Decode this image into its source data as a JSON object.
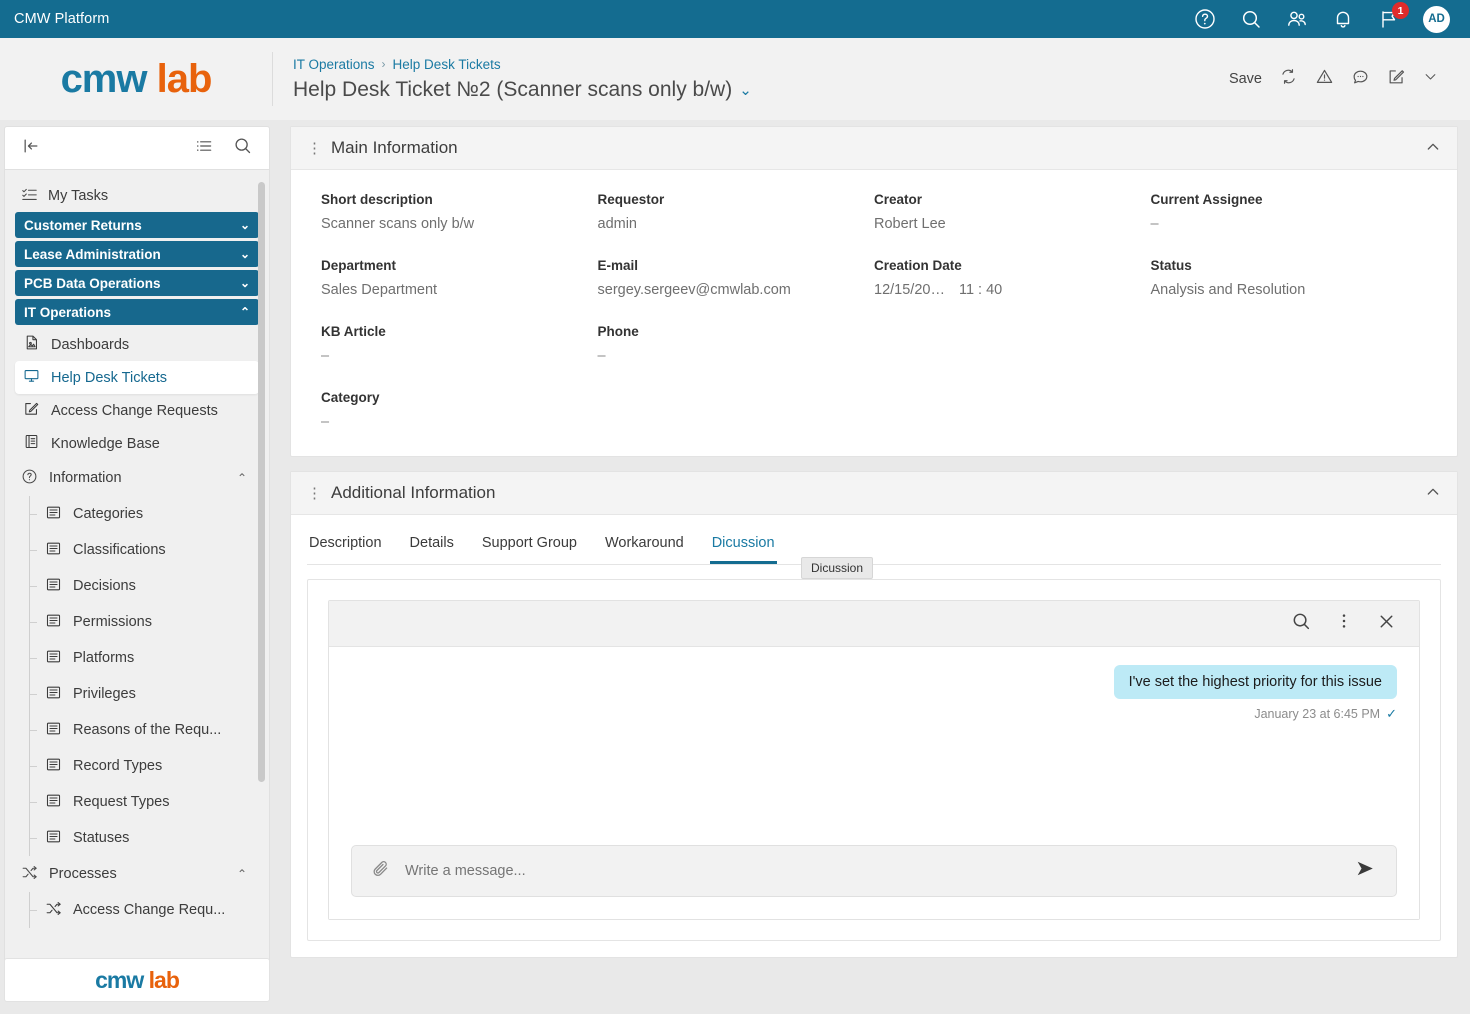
{
  "topbar": {
    "title": "CMW Platform",
    "icons": [
      "help-icon",
      "search-icon",
      "users-icon",
      "bell-icon",
      "flag-icon"
    ],
    "notification_count": "1",
    "avatar_initials": "AD",
    "background": "#146c90"
  },
  "header": {
    "logo_part1": "cmw",
    "logo_part2": "lab",
    "breadcrumb": [
      "IT Operations",
      "Help Desk Tickets"
    ],
    "breadcrumb_separator": "›",
    "record_title": "Help Desk Ticket №2 (Scanner scans only b/w)",
    "title_chevron": "⌄",
    "accent_blue": "#1a7aa3",
    "accent_orange": "#e8620c"
  },
  "toolbar": {
    "save_label": "Save",
    "icons": [
      "refresh-icon",
      "warning-icon",
      "comment-icon",
      "edit-icon",
      "chevron-down-icon"
    ]
  },
  "sidebar": {
    "collapse_label": "|←",
    "list_icon": "list-icon",
    "search_icon": "search-icon",
    "my_tasks": "My Tasks",
    "groups": [
      {
        "label": "Customer Returns",
        "chevron": "⌄",
        "expanded": false
      },
      {
        "label": "Lease Administration",
        "chevron": "⌄",
        "expanded": false
      },
      {
        "label": "PCB Data Operations",
        "chevron": "⌄",
        "expanded": false
      },
      {
        "label": "IT Operations",
        "chevron": "⌃",
        "expanded": true
      }
    ],
    "items": [
      {
        "label": "Dashboards",
        "icon": "document-icon",
        "active": false
      },
      {
        "label": "Help Desk Tickets",
        "icon": "monitor-icon",
        "active": true
      },
      {
        "label": "Access Change Requests",
        "icon": "edit-square-icon",
        "active": false
      },
      {
        "label": "Knowledge Base",
        "icon": "book-icon",
        "active": false
      }
    ],
    "information_section": {
      "label": "Information",
      "icon": "question-circle-icon",
      "chevron": "⌃"
    },
    "information_items": [
      "Categories",
      "Classifications",
      "Decisions",
      "Permissions",
      "Platforms",
      "Privileges",
      "Reasons of the Requ...",
      "Record Types",
      "Request Types",
      "Statuses"
    ],
    "processes_section": {
      "label": "Processes",
      "icon": "process-icon",
      "chevron": "⌃"
    },
    "processes_items": [
      "Access Change Requ..."
    ],
    "footer_logo_part1": "cmw",
    "footer_logo_part2": "lab",
    "group_color": "#17688d"
  },
  "main_information": {
    "panel_title": "Main Information",
    "collapse_chevron": "⌃",
    "rows": [
      [
        {
          "label": "Short description",
          "value": "Scanner scans only b/w"
        },
        {
          "label": "Requestor",
          "value": "admin"
        },
        {
          "label": "Creator",
          "value": "Robert Lee"
        },
        {
          "label": "Current Assignee",
          "value": "–"
        }
      ],
      [
        {
          "label": "Department",
          "value": "Sales Department"
        },
        {
          "label": "E-mail",
          "value": "sergey.sergeev@cmwlab.com"
        },
        {
          "label": "Creation Date",
          "value": "12/15/20…",
          "value2": "11 : 40"
        },
        {
          "label": "Status",
          "value": "Analysis and Resolution"
        }
      ],
      [
        {
          "label": "KB Article",
          "value": "–"
        },
        {
          "label": "Phone",
          "value": "–"
        },
        {
          "label": "",
          "value": ""
        },
        {
          "label": "",
          "value": ""
        }
      ],
      [
        {
          "label": "Category",
          "value": "–"
        },
        {
          "label": "",
          "value": ""
        },
        {
          "label": "",
          "value": ""
        },
        {
          "label": "",
          "value": ""
        }
      ]
    ]
  },
  "additional_information": {
    "panel_title": "Additional Information",
    "collapse_chevron": "⌃",
    "tabs": [
      {
        "label": "Description",
        "active": false
      },
      {
        "label": "Details",
        "active": false
      },
      {
        "label": "Support Group",
        "active": false
      },
      {
        "label": "Workaround",
        "active": false
      },
      {
        "label": "Dicussion",
        "active": true
      }
    ],
    "tooltip": "Dicussion"
  },
  "chat": {
    "header_icons": [
      "search-icon",
      "kebab-menu-icon",
      "close-icon"
    ],
    "messages": [
      {
        "text": "I've set the highest priority for this issue",
        "timestamp": "January 23 at 6:45 PM",
        "status_icon": "check-icon",
        "outgoing": true,
        "bubble_color": "#bdeaf6"
      }
    ],
    "composer": {
      "attach_icon": "paperclip-icon",
      "placeholder": "Write a message...",
      "value": "",
      "send_icon": "send-icon"
    }
  }
}
